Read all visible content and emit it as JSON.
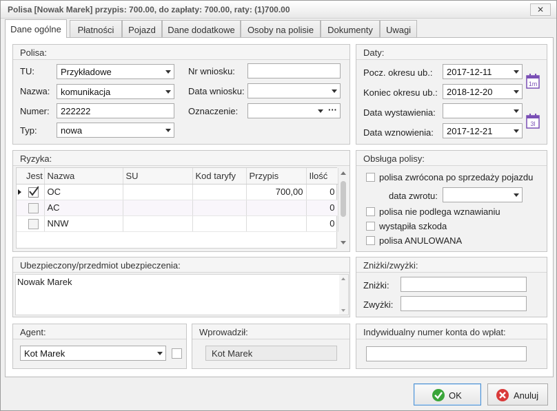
{
  "window": {
    "title": "Polisa [Nowak Marek] przypis: 700.00, do zapłaty: 700.00, raty: (1)700.00",
    "close_glyph": "✕"
  },
  "tabs": [
    {
      "label": "Dane ogólne",
      "active": true
    },
    {
      "label": "Płatności"
    },
    {
      "label": "Pojazd"
    },
    {
      "label": "Dane dodatkowe"
    },
    {
      "label": "Osoby na polisie"
    },
    {
      "label": "Dokumenty"
    },
    {
      "label": "Uwagi"
    }
  ],
  "polisa": {
    "header": "Polisa:",
    "tu_label": "TU:",
    "tu_value": "Przykładowe",
    "nazwa_label": "Nazwa:",
    "nazwa_value": "komunikacja",
    "numer_label": "Numer:",
    "numer_value": "222222",
    "typ_label": "Typ:",
    "typ_value": "nowa",
    "nr_wniosku_label": "Nr wniosku:",
    "nr_wniosku_value": "",
    "data_wniosku_label": "Data wniosku:",
    "data_wniosku_value": "",
    "oznaczenie_label": "Oznaczenie:",
    "oznaczenie_value": "",
    "oznaczenie_more": "···"
  },
  "daty": {
    "header": "Daty:",
    "pocz_label": "Pocz. okresu ub.:",
    "pocz_value": "2017-12-11",
    "koniec_label": "Koniec okresu ub.:",
    "koniec_value": "2018-12-20",
    "wystawienia_label": "Data wystawienia:",
    "wystawienia_value": "",
    "wznowienia_label": "Data wznowienia:",
    "wznowienia_value": "2017-12-21",
    "cal1_text": "1m",
    "cal2_text": "3l"
  },
  "ryzyka": {
    "header": "Ryzyka:",
    "columns": [
      "Jest",
      "Nazwa",
      "SU",
      "Kod taryfy",
      "Przypis",
      "Ilość"
    ],
    "rows": [
      {
        "checked": true,
        "nazwa": "OC",
        "su": "",
        "kod": "",
        "przypis": "700,00",
        "ilosc": "0"
      },
      {
        "checked": false,
        "nazwa": "AC",
        "su": "",
        "kod": "",
        "przypis": "",
        "ilosc": "0"
      },
      {
        "checked": false,
        "nazwa": "NNW",
        "su": "",
        "kod": "",
        "przypis": "",
        "ilosc": "0"
      }
    ]
  },
  "obsluga": {
    "header": "Obsługa polisy:",
    "zwrocona": "polisa zwrócona po sprzedaży pojazdu",
    "data_zwrotu_label": "data zwrotu:",
    "data_zwrotu_value": "",
    "nie_podlega": "polisa nie podlega wznawianiu",
    "szkoda": "wystąpiła szkoda",
    "anulowana": "polisa ANULOWANA"
  },
  "ubezpieczony": {
    "header": "Ubezpieczony/przedmiot ubezpieczenia:",
    "value": "Nowak  Marek"
  },
  "znizki": {
    "header": "Zniżki/zwyżki:",
    "znizki_label": "Zniżki:",
    "znizki_value": "",
    "zwyzki_label": "Zwyżki:",
    "zwyzki_value": ""
  },
  "agent": {
    "header": "Agent:",
    "value": "Kot Marek"
  },
  "wprowadzil": {
    "header": "Wprowadził:",
    "value": "Kot Marek"
  },
  "konto": {
    "header": "Indywidualny numer konta do wpłat:",
    "value": ""
  },
  "buttons": {
    "ok": "OK",
    "cancel": "Anuluj"
  },
  "colors": {
    "ok_icon": "#3aa53a",
    "cancel_icon": "#d93a3a",
    "calendar": "#7a4fb5"
  }
}
